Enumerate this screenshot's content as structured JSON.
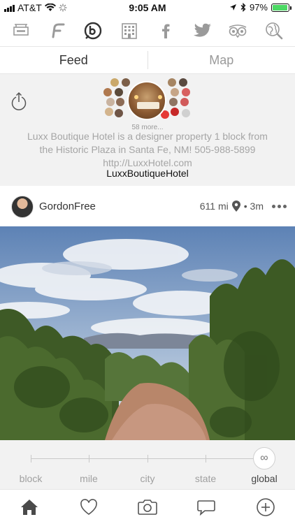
{
  "status_bar": {
    "carrier": "AT&T",
    "time": "9:05 AM",
    "battery": "97%",
    "battery_level": 0.97,
    "battery_color": "#4cd964"
  },
  "social_icons": [
    "hotel-sign-icon",
    "foursquare-icon",
    "b-logo-icon",
    "building-icon",
    "facebook-icon",
    "twitter-icon",
    "tripadvisor-icon",
    "search-globe-icon"
  ],
  "tabs": {
    "feed": "Feed",
    "map": "Map",
    "active": "feed"
  },
  "hotel": {
    "more_count": "58 more...",
    "description": "Luxx Boutique Hotel is a designer property 1 block from the Historic Plaza in Santa Fe, NM! 505-988-5899 http://LuxxHotel.com",
    "name": "LuxxBoutiqueHotel"
  },
  "post": {
    "username": "GordonFree",
    "distance": "611 mi",
    "time_ago": "• 3m"
  },
  "range": {
    "labels": [
      "block",
      "mile",
      "city",
      "state",
      "global"
    ],
    "selected": "global",
    "knob_symbol": "∞"
  },
  "bottom_nav": [
    "home-icon",
    "heart-icon",
    "camera-icon",
    "chat-icon",
    "add-icon"
  ],
  "colors": {
    "background_gray": "#f2f2f2",
    "muted_text": "#a5a5a5",
    "dark_icon": "#4a4a4a"
  }
}
